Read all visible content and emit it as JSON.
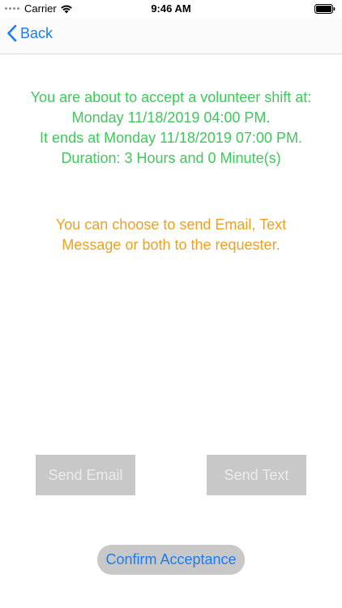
{
  "status_bar": {
    "carrier": "Carrier",
    "time": "9:46 AM"
  },
  "nav": {
    "back_label": "Back"
  },
  "message": {
    "lines": [
      "You are about to accept a volunteer shift at:",
      "Monday 11/18/2019 04:00 PM.",
      "It ends at Monday 11/18/2019 07:00 PM.",
      "Duration: 3 Hours and 0 Minute(s)"
    ],
    "color": "#3ec95a"
  },
  "notice": {
    "text": "You can choose to send Email, Text Message or both to the requester.",
    "color": "#f0a020"
  },
  "buttons": {
    "send_email": "Send Email",
    "send_text": "Send Text",
    "confirm": "Confirm Acceptance"
  },
  "colors": {
    "accent": "#1a7cf4",
    "button_gray": "#c8c8c8"
  },
  "icons": {
    "back": "chevron-left-icon",
    "wifi": "wifi-icon",
    "battery": "battery-icon",
    "signal": "signal-dots-icon"
  }
}
